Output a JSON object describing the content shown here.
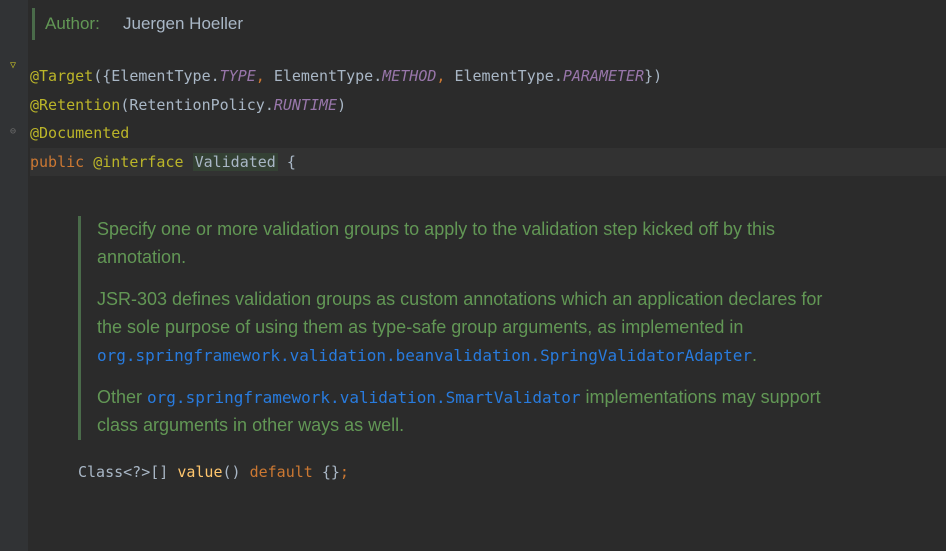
{
  "doc": {
    "author_label": "Author:",
    "author_name": "Juergen Hoeller"
  },
  "line1": {
    "at_target": "@Target",
    "open": "({",
    "et1": "ElementType",
    "dot": ".",
    "type_const": "TYPE",
    "comma": ",",
    "et2": "ElementType",
    "method_const": "METHOD",
    "et3": "ElementType",
    "param_const": "PARAMETER",
    "close": "})"
  },
  "line2": {
    "at_retention": "@Retention",
    "open": "(",
    "rp": "RetentionPolicy",
    "dot": ".",
    "runtime_const": "RUNTIME",
    "close": ")"
  },
  "line3": {
    "at_documented": "@Documented"
  },
  "line4": {
    "public_kw": "public",
    "at_interface": "@interface",
    "class_name": "Validated",
    "brace": "{"
  },
  "javadoc": {
    "p1": "Specify one or more validation groups to apply to the validation step kicked off by this annotation.",
    "p2a": "JSR-303 defines validation groups as custom annotations which an application declares for the sole purpose of using them as type-safe group arguments, as implemented in ",
    "p2code": "org.springframework.validation.beanvalidation.SpringValidatorAdapter",
    "p2end": ".",
    "p3a": "Other ",
    "p3code": "org.springframework.validation.SmartValidator",
    "p3b": " implementations may support class arguments in other ways as well."
  },
  "method": {
    "classtype": "Class",
    "generic": "<?>[]",
    "name": "value",
    "parens": "()",
    "default_kw": "default",
    "braces": "{}",
    "semi": ";"
  }
}
